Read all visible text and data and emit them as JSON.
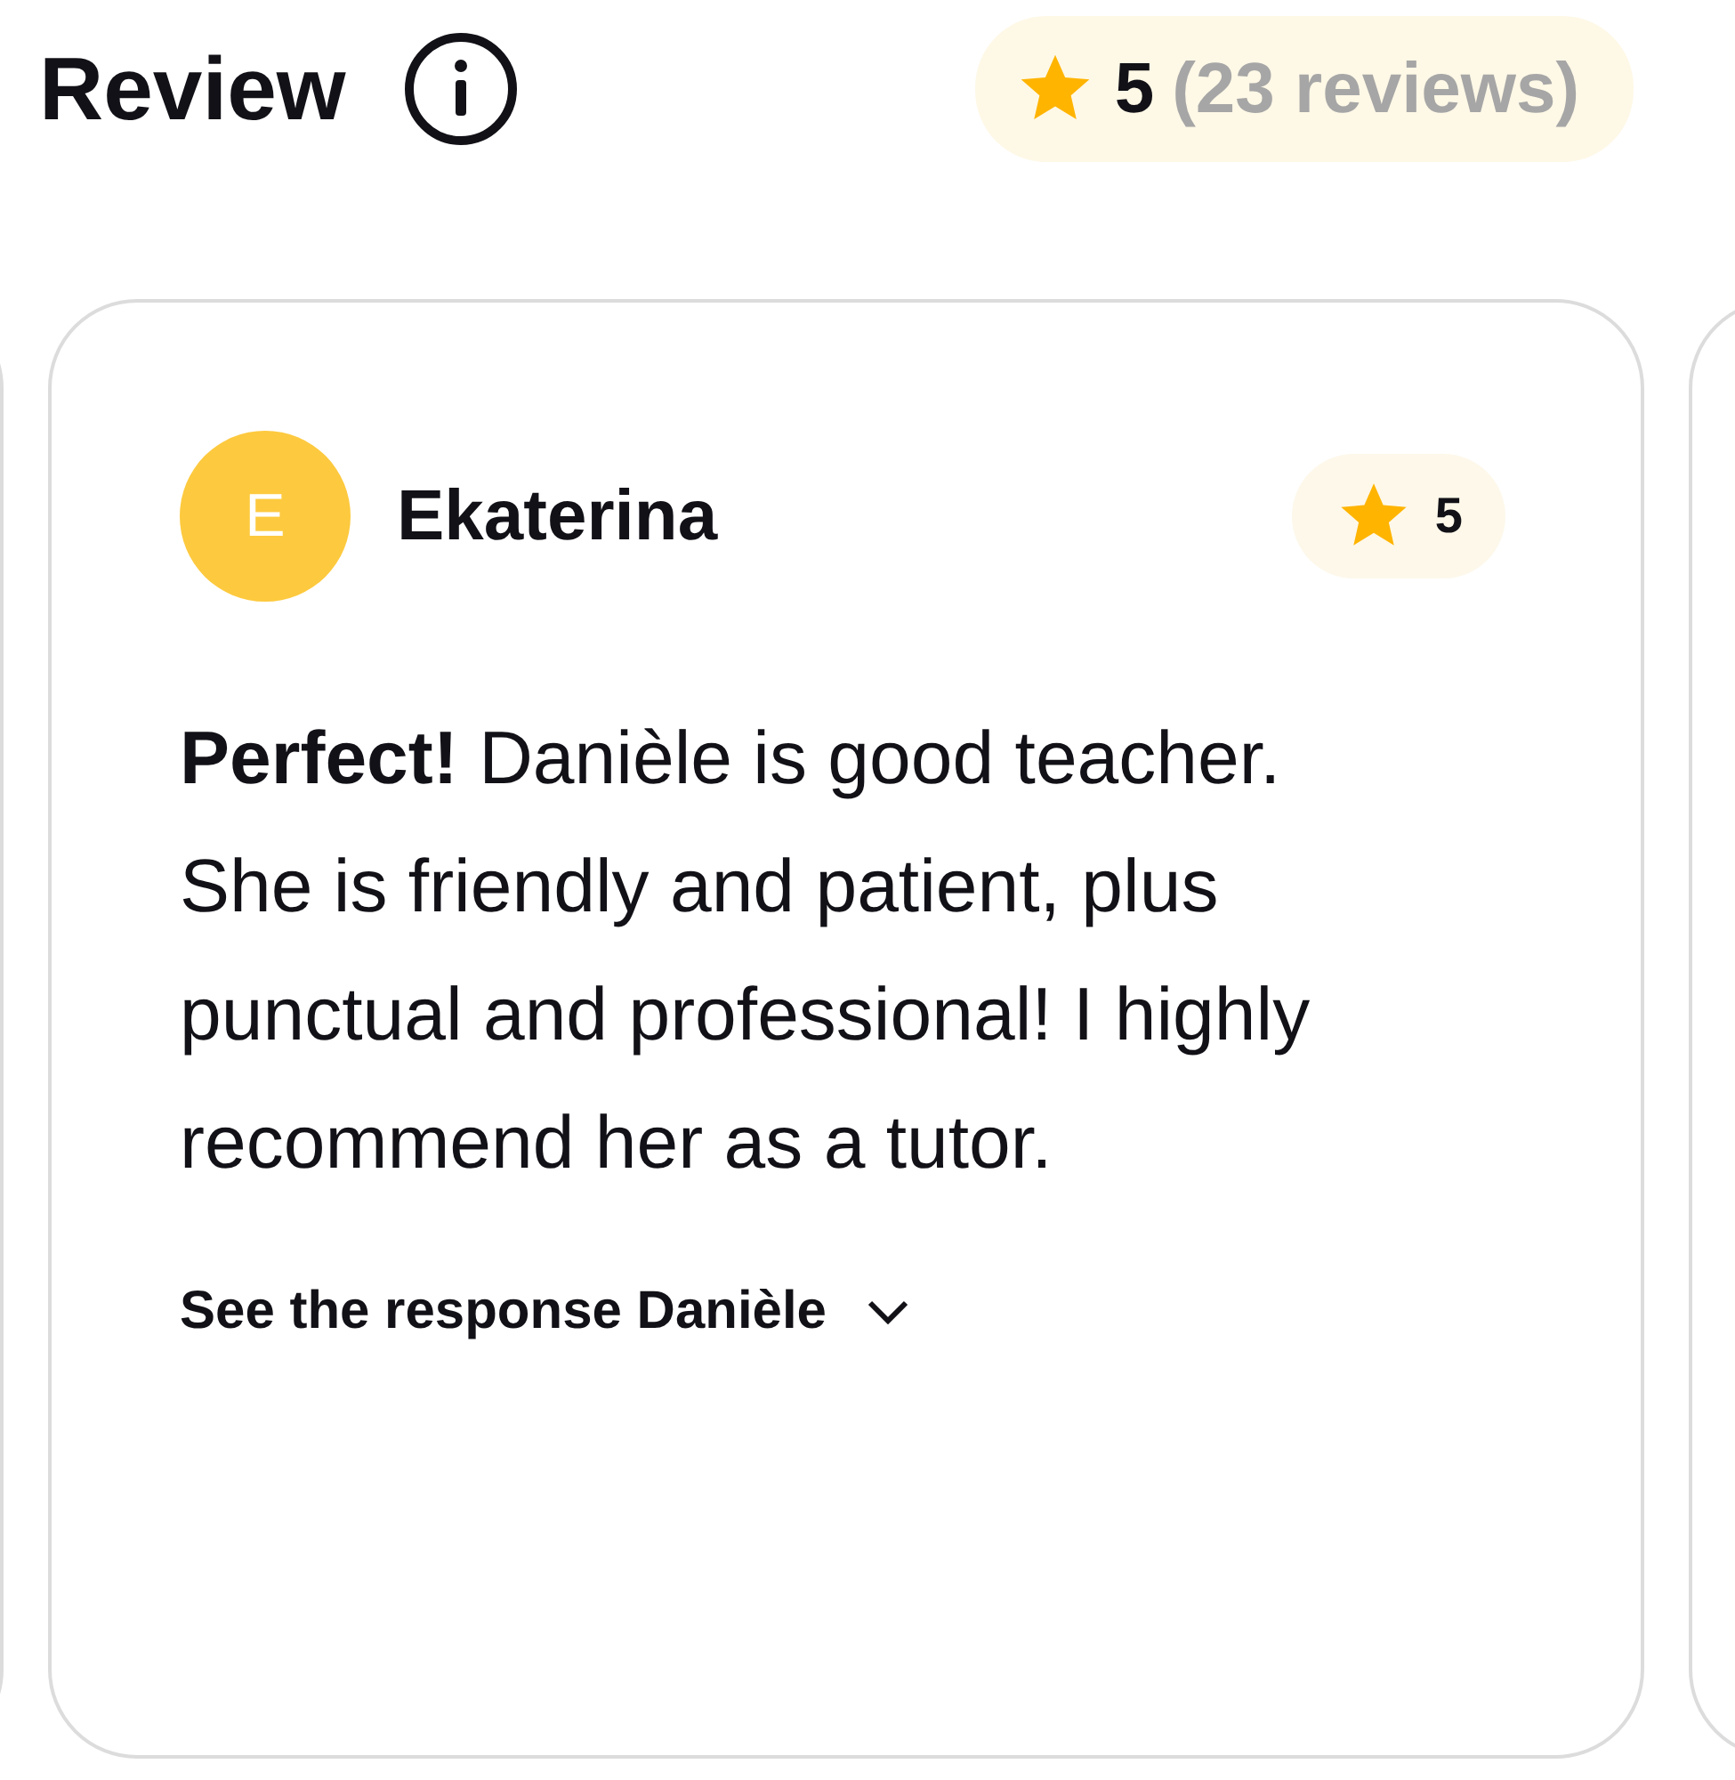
{
  "header": {
    "title": "Review",
    "rating": "5",
    "review_count": "(23 reviews)"
  },
  "reviews": [
    {
      "avatar_letter": "E",
      "name": "Ekaterina",
      "rating": "5",
      "text": "**Perfect!** Danièle is good teacher. She is friendly and patient, plus punctual and professional! I highly recommend her as a tutor.",
      "response_link": "See the response Danièle",
      "expanded": false
    }
  ]
}
